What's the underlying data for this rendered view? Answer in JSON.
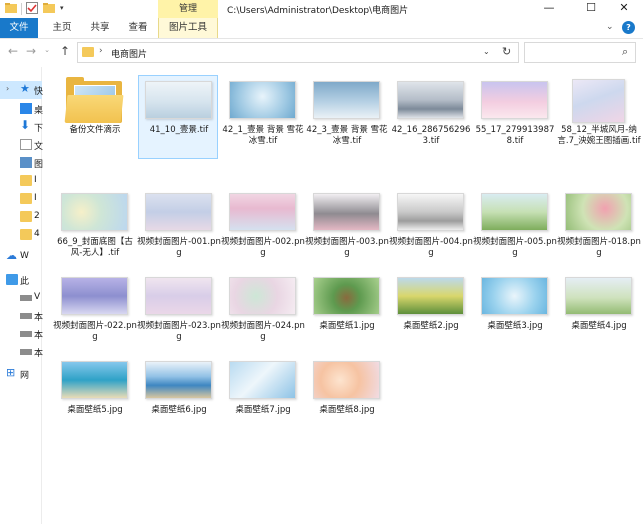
{
  "titlebar": {
    "manage_label": "管理",
    "path_title": "C:\\Users\\Administrator\\Desktop\\电商图片",
    "minimize": "—",
    "maximize": "☐",
    "close": "✕",
    "qa_arrow": "▾"
  },
  "ribbon": {
    "file": "文件",
    "home": "主页",
    "share": "共享",
    "view": "查看",
    "picture_tools": "图片工具",
    "chevron": "⌄",
    "help": "?"
  },
  "nav": {
    "back": "←",
    "forward": "→",
    "recent": "⌄",
    "up": "↑",
    "address_sep": "›",
    "address_text": "电商图片",
    "address_dropdown": "⌄",
    "refresh": "↻",
    "search_icon": "⌕"
  },
  "navpane": {
    "quick_arrow": "›",
    "quick_label": "快",
    "items": [
      {
        "label": "桌",
        "icon": "desktop-icon"
      },
      {
        "label": "下",
        "icon": "download-icon"
      },
      {
        "label": "文",
        "icon": "document-icon"
      },
      {
        "label": "图",
        "icon": "picture-icon"
      },
      {
        "label": "I",
        "icon": "folder-icon"
      },
      {
        "label": "I",
        "icon": "folder-icon"
      },
      {
        "label": "2",
        "icon": "folder-icon"
      },
      {
        "label": "4",
        "icon": "folder-icon"
      }
    ],
    "onedrive": "W",
    "thispc": "此",
    "pc_items": [
      "V",
      "本",
      "本",
      "本"
    ],
    "network": "网"
  },
  "files": [
    {
      "name": "备份文件滴示",
      "type": "folder"
    },
    {
      "name": "41_10_壹景.tif",
      "type": "image",
      "selected": true
    },
    {
      "name": "42_1_壹景 背景 雪花 冰雪.tif",
      "type": "image"
    },
    {
      "name": "42_3_壹景 背景 雪花 冰雪.tif",
      "type": "image"
    },
    {
      "name": "42_16_2867562963.tif",
      "type": "image"
    },
    {
      "name": "55_17_2799139878.tif",
      "type": "image"
    },
    {
      "name": "58_12_半城风月-纳言.7_泱婉王图插画.tif",
      "type": "image"
    },
    {
      "name": "66_9_封面底图【古风-无人】.tif",
      "type": "image"
    },
    {
      "name": "视频封面图片-001.png",
      "type": "image"
    },
    {
      "name": "视频封面图片-002.png",
      "type": "image"
    },
    {
      "name": "视频封面图片-003.png",
      "type": "image"
    },
    {
      "name": "视频封面图片-004.png",
      "type": "image"
    },
    {
      "name": "视频封面图片-005.png",
      "type": "image"
    },
    {
      "name": "视频封面图片-018.png",
      "type": "image"
    },
    {
      "name": "视频封面图片-022.png",
      "type": "image"
    },
    {
      "name": "视频封面图片-023.png",
      "type": "image"
    },
    {
      "name": "视频封面图片-024.png",
      "type": "image"
    },
    {
      "name": "桌面壁纸1.jpg",
      "type": "image"
    },
    {
      "name": "桌面壁纸2.jpg",
      "type": "image"
    },
    {
      "name": "桌面壁纸3.jpg",
      "type": "image"
    },
    {
      "name": "桌面壁纸4.jpg",
      "type": "image"
    },
    {
      "name": "桌面壁纸5.jpg",
      "type": "image"
    },
    {
      "name": "桌面壁纸6.jpg",
      "type": "image"
    },
    {
      "name": "桌面壁纸7.jpg",
      "type": "image"
    },
    {
      "name": "桌面壁纸8.jpg",
      "type": "image"
    }
  ]
}
